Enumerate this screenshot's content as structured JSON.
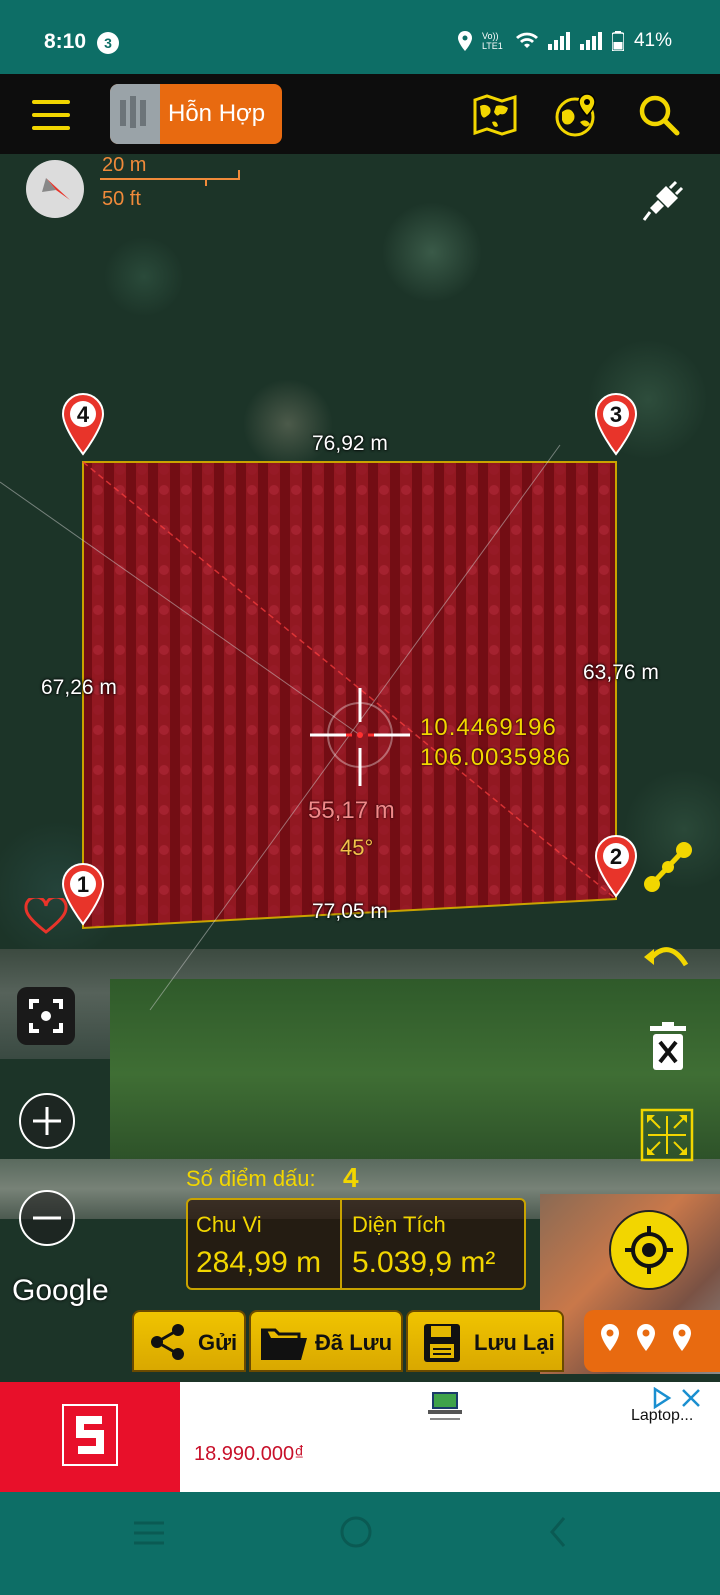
{
  "status_bar": {
    "time": "8:10",
    "notification_count": "3",
    "network_label": "Vo)) LTE1",
    "battery": "41%"
  },
  "toolbar": {
    "map_type_label": "Hỗn Hợp",
    "icons": [
      "menu-icon",
      "world-map-icon",
      "globe-pin-icon",
      "search-icon"
    ]
  },
  "scale": {
    "metric": "20 m",
    "imperial": "50 ft"
  },
  "measurements": {
    "top_edge": "76,92 m",
    "bottom_edge": "77,05 m",
    "left_edge": "67,26 m",
    "right_edge": "63,76 m",
    "diagonal": "55,17 m",
    "angle": "45°"
  },
  "crosshair": {
    "latitude": "10.4469196",
    "longitude": "106.0035986"
  },
  "markers": [
    {
      "label": "1"
    },
    {
      "label": "2"
    },
    {
      "label": "3"
    },
    {
      "label": "4"
    }
  ],
  "map_attribution": "Google",
  "info": {
    "points_label": "Số điểm dấu:",
    "points_value": "4",
    "perimeter_label": "Chu Vi",
    "perimeter_value": "284,99 m",
    "area_label": "Diện Tích",
    "area_value": "5.039,9 m²"
  },
  "bottom_buttons": {
    "send": "Gửi",
    "saved": "Đã Lưu",
    "save": "Lưu Lại"
  },
  "ad": {
    "price": "18.990.000₫",
    "product": "Laptop..."
  },
  "colors": {
    "status_bar": "#0d6e66",
    "accent_yellow": "#f2d600",
    "accent_orange": "#e86a10",
    "polygon_fill": "#8b0a14",
    "ad_red": "#e8102a"
  }
}
